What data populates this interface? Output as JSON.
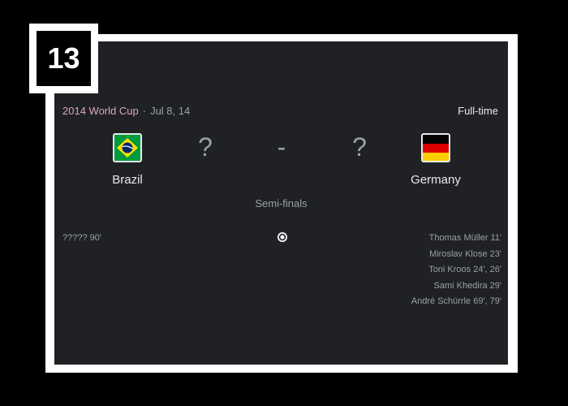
{
  "badge": {
    "number": "13"
  },
  "match": {
    "competition": "2014 World Cup",
    "separator": "·",
    "date": "Jul 8, 14",
    "status": "Full-time",
    "stage": "Semi-finals",
    "home": {
      "name": "Brazil",
      "score": "?",
      "flag": "brazil-flag-icon",
      "scorers": [
        "????? 90'"
      ]
    },
    "away": {
      "name": "Germany",
      "score": "?",
      "flag": "germany-flag-icon",
      "scorers": [
        "Thomas Müller 11'",
        "Miroslav Klose 23'",
        "Toni Kroos 24', 26'",
        "Sami Khedira 29'",
        "André Schürrle 69', 79'"
      ]
    },
    "score_separator": "-"
  },
  "colors": {
    "card_background": "#202124",
    "competition_accent": "#d7a6c8",
    "frame": "#ffffff"
  }
}
